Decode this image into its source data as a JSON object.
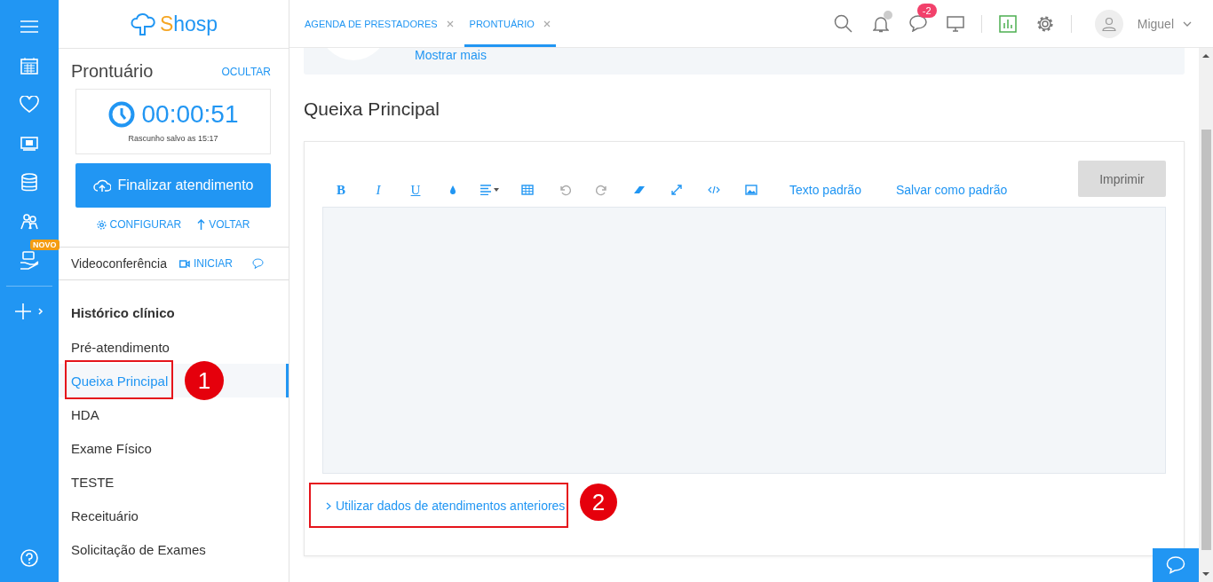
{
  "rail": {
    "badge": "NOVO"
  },
  "brand": {
    "name": "Shosp"
  },
  "record": {
    "title": "Prontuário",
    "hide": "OCULTAR",
    "timer": "00:00:51",
    "draft_note": "Rascunho salvo as 15:17",
    "finish_button": "Finalizar atendimento",
    "configure": "CONFIGURAR",
    "back": "VOLTAR"
  },
  "video": {
    "label": "Videoconferência",
    "start": "INICIAR"
  },
  "nav": {
    "header": "Histórico clínico",
    "items": [
      {
        "label": "Pré-atendimento",
        "selected": false
      },
      {
        "label": "Queixa Principal",
        "selected": true,
        "annotation": "1"
      },
      {
        "label": "HDA",
        "selected": false
      },
      {
        "label": "Exame Físico",
        "selected": false
      },
      {
        "label": "TESTE",
        "selected": false
      },
      {
        "label": "Receituário",
        "selected": false
      },
      {
        "label": "Solicitação de Exames",
        "selected": false
      }
    ]
  },
  "tabs": [
    {
      "label": "AGENDA DE PRESTADORES",
      "selected": false
    },
    {
      "label": "PRONTUÁRIO",
      "selected": true
    }
  ],
  "header": {
    "chat_badge": "-2",
    "user": "Miguel"
  },
  "summary": {
    "more": "Mostrar mais"
  },
  "section": {
    "title": "Queixa Principal",
    "format_buttons": [
      "B",
      "I",
      "U"
    ],
    "text_actions": [
      "Texto padrão",
      "Salvar como padrão"
    ],
    "print": "Imprimir",
    "previous_link": "Utilizar dados de atendimentos anteriores",
    "previous_annotation": "2"
  }
}
